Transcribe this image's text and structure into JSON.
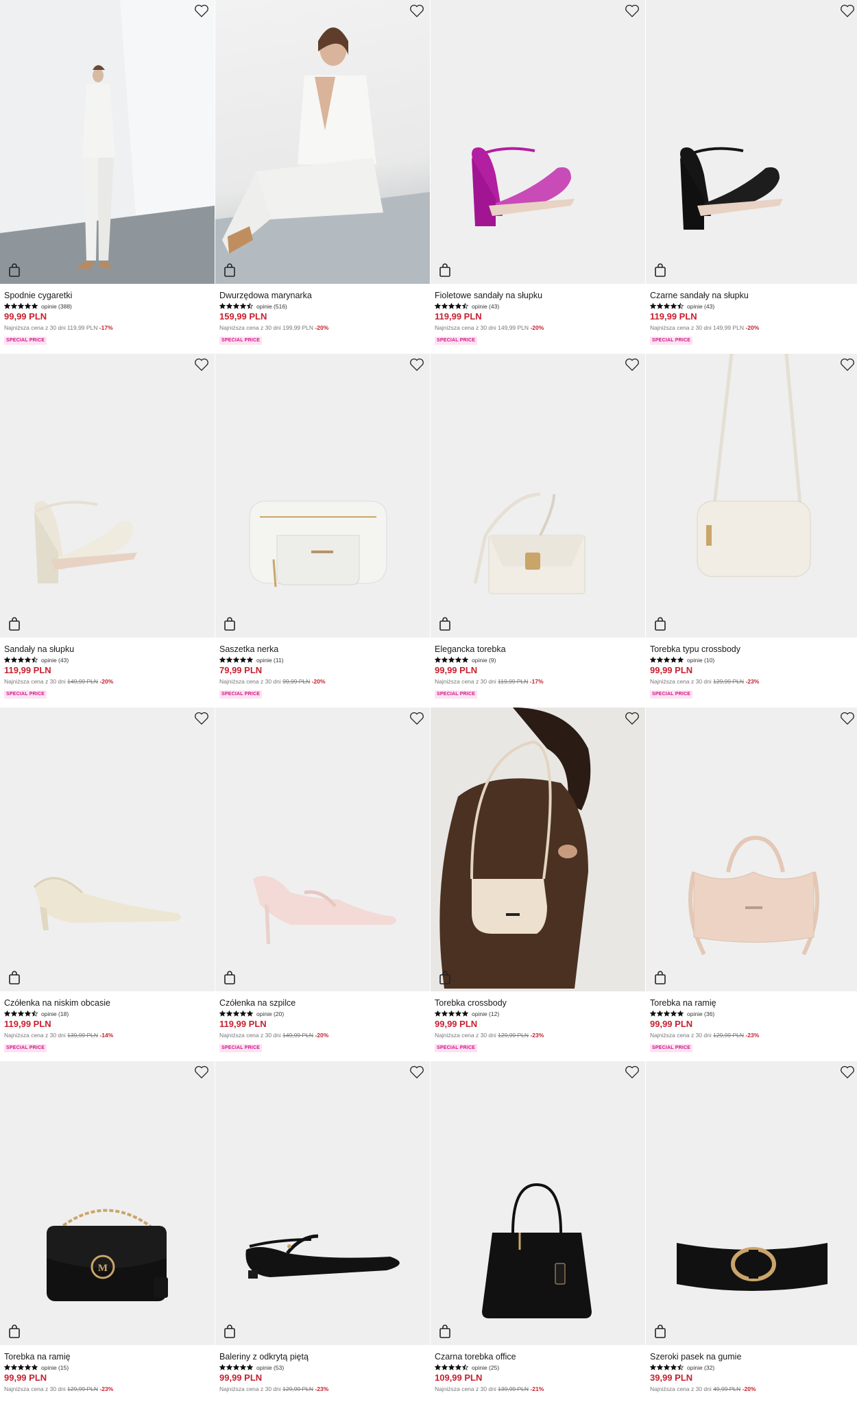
{
  "products": [
    {
      "name": "Spodnie cygaretki",
      "rating": 5,
      "reviews": "opinie (388)",
      "price": "99,99 PLN",
      "lowest_label": "Najniższa cena z 30 dni",
      "lowest_price": "119,99 PLN",
      "lowest_strike": false,
      "discount": "-17%",
      "badge": "SPECIAL PRICE"
    },
    {
      "name": "Dwurzędowa marynarka",
      "rating": 4.5,
      "reviews": "opinie (516)",
      "price": "159,99 PLN",
      "lowest_label": "Najniższa cena z 30 dni",
      "lowest_price": "199,99 PLN",
      "lowest_strike": false,
      "discount": "-20%",
      "badge": "SPECIAL PRICE"
    },
    {
      "name": "Fioletowe sandały na słupku",
      "rating": 4.5,
      "reviews": "opinie (43)",
      "price": "119,99 PLN",
      "lowest_label": "Najniższa cena z 30 dni",
      "lowest_price": "149,99 PLN",
      "lowest_strike": false,
      "discount": "-20%",
      "badge": "SPECIAL PRICE"
    },
    {
      "name": "Czarne sandały na słupku",
      "rating": 4.5,
      "reviews": "opinie (43)",
      "price": "119,99 PLN",
      "lowest_label": "Najniższa cena z 30 dni",
      "lowest_price": "149,99 PLN",
      "lowest_strike": false,
      "discount": "-20%",
      "badge": "SPECIAL PRICE"
    },
    {
      "name": "Sandały na słupku",
      "rating": 4.5,
      "reviews": "opinie (43)",
      "price": "119,99 PLN",
      "lowest_label": "Najniższa cena z 30 dni",
      "lowest_price": "149,99 PLN",
      "lowest_strike": true,
      "discount": "-20%",
      "badge": "SPECIAL PRICE"
    },
    {
      "name": "Saszetka nerka",
      "rating": 5,
      "reviews": "opinie (11)",
      "price": "79,99 PLN",
      "lowest_label": "Najniższa cena z 30 dni",
      "lowest_price": "99,99 PLN",
      "lowest_strike": true,
      "discount": "-20%",
      "badge": "SPECIAL PRICE"
    },
    {
      "name": "Elegancka torebka",
      "rating": 5,
      "reviews": "opinie (9)",
      "price": "99,99 PLN",
      "lowest_label": "Najniższa cena z 30 dni",
      "lowest_price": "119,99 PLN",
      "lowest_strike": true,
      "discount": "-17%",
      "badge": "SPECIAL PRICE"
    },
    {
      "name": "Torebka typu crossbody",
      "rating": 5,
      "reviews": "opinie (10)",
      "price": "99,99 PLN",
      "lowest_label": "Najniższa cena z 30 dni",
      "lowest_price": "129,99 PLN",
      "lowest_strike": true,
      "discount": "-23%",
      "badge": "SPECIAL PRICE"
    },
    {
      "name": "Czółenka na niskim obcasie",
      "rating": 4.5,
      "reviews": "opinie (18)",
      "price": "119,99 PLN",
      "lowest_label": "Najniższa cena z 30 dni",
      "lowest_price": "139,99 PLN",
      "lowest_strike": true,
      "discount": "-14%",
      "badge": "SPECIAL PRICE"
    },
    {
      "name": "Czółenka na szpilce",
      "rating": 5,
      "reviews": "opinie (20)",
      "price": "119,99 PLN",
      "lowest_label": "Najniższa cena z 30 dni",
      "lowest_price": "149,99 PLN",
      "lowest_strike": true,
      "discount": "-20%",
      "badge": "SPECIAL PRICE"
    },
    {
      "name": "Torebka crossbody",
      "rating": 5,
      "reviews": "opinie (12)",
      "price": "99,99 PLN",
      "lowest_label": "Najniższa cena z 30 dni",
      "lowest_price": "129,99 PLN",
      "lowest_strike": true,
      "discount": "-23%",
      "badge": "SPECIAL PRICE"
    },
    {
      "name": "Torebka na ramię",
      "rating": 5,
      "reviews": "opinie (36)",
      "price": "99,99 PLN",
      "lowest_label": "Najniższa cena z 30 dni",
      "lowest_price": "129,99 PLN",
      "lowest_strike": true,
      "discount": "-23%",
      "badge": "SPECIAL PRICE"
    },
    {
      "name": "Torebka na ramię",
      "rating": 5,
      "reviews": "opinie (15)",
      "price": "99,99 PLN",
      "lowest_label": "Najniższa cena z 30 dni",
      "lowest_price": "129,99 PLN",
      "lowest_strike": true,
      "discount": "-23%",
      "badge": ""
    },
    {
      "name": "Baleriny z odkrytą piętą",
      "rating": 5,
      "reviews": "opinie (53)",
      "price": "99,99 PLN",
      "lowest_label": "Najniższa cena z 30 dni",
      "lowest_price": "129,99 PLN",
      "lowest_strike": true,
      "discount": "-23%",
      "badge": ""
    },
    {
      "name": "Czarna torebka office",
      "rating": 4.5,
      "reviews": "opinie (25)",
      "price": "109,99 PLN",
      "lowest_label": "Najniższa cena z 30 dni",
      "lowest_price": "139,99 PLN",
      "lowest_strike": true,
      "discount": "-21%",
      "badge": ""
    },
    {
      "name": "Szeroki pasek na gumie",
      "rating": 4.5,
      "reviews": "opinie (32)",
      "price": "39,99 PLN",
      "lowest_label": "Najniższa cena z 30 dni",
      "lowest_price": "49,99 PLN",
      "lowest_strike": true,
      "discount": "-20%",
      "badge": ""
    }
  ],
  "icons": {
    "wishlist": "heart-outline-icon",
    "add_to_bag": "shopping-bag-icon",
    "rating": "star-icon"
  },
  "colors": {
    "price": "#c7202f",
    "badge_text": "#d2148b",
    "badge_bg": "#fde3f1"
  }
}
